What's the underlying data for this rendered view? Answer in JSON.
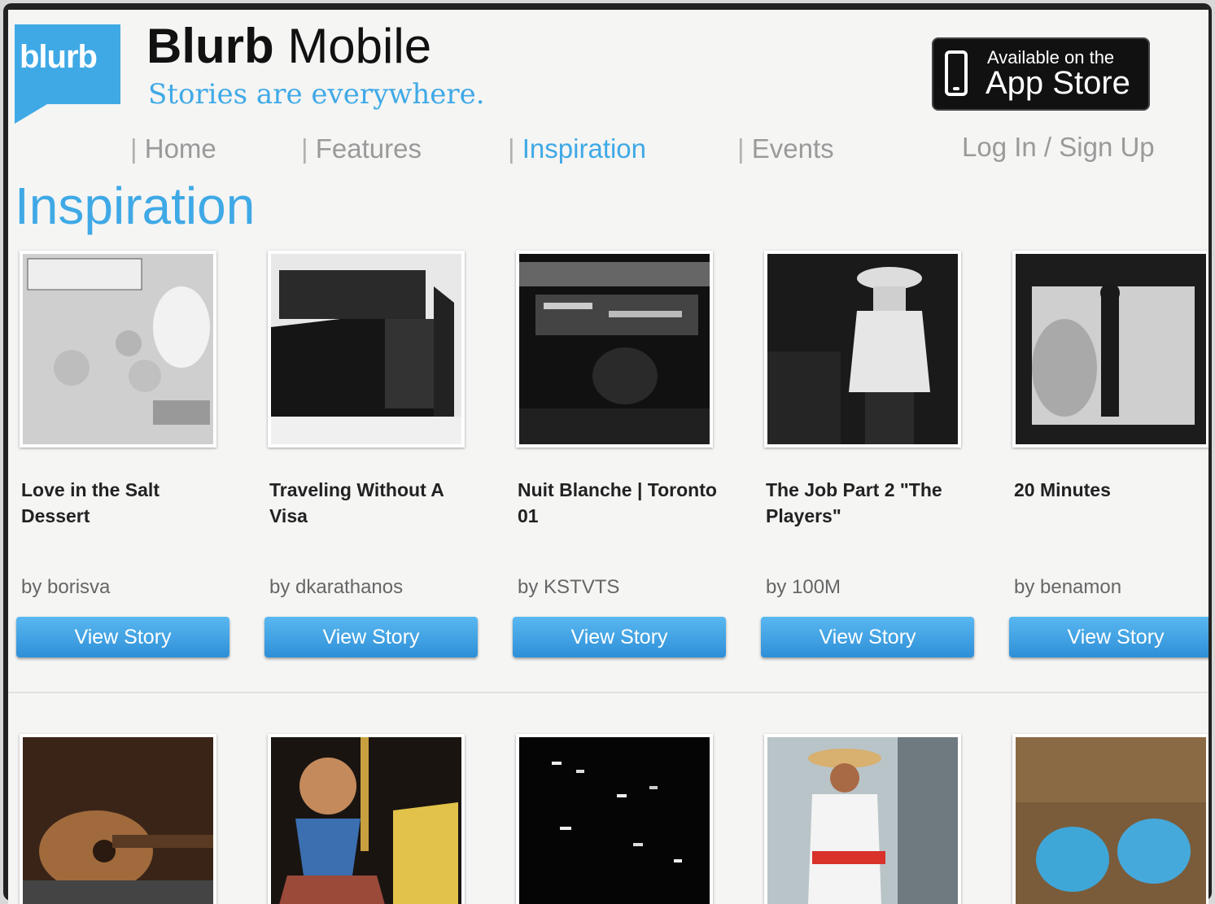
{
  "header": {
    "logo_text": "blurb",
    "brand_bold": "Blurb",
    "brand_rest": " Mobile",
    "tagline": "Stories are everywhere.",
    "appstore_small": "Available on the",
    "appstore_big": "App Store"
  },
  "nav": {
    "sep": "|",
    "home": "Home",
    "features": "Features",
    "inspiration": "Inspiration",
    "events": "Events",
    "login": "Log In / Sign Up"
  },
  "page_heading": "Inspiration",
  "stories": [
    {
      "title": "Love in the Salt Dessert",
      "author": "by borisva",
      "button": "View Story"
    },
    {
      "title": "Traveling Without A Visa",
      "author": "by dkarathanos",
      "button": "View Story"
    },
    {
      "title": "Nuit Blanche | Toronto 01",
      "author": "by KSTVTS",
      "button": "View Story"
    },
    {
      "title": "The Job Part 2 \"The Players\"",
      "author": "by 100M",
      "button": "View Story"
    },
    {
      "title": "20 Minutes",
      "author": "by benamon",
      "button": "View Story"
    }
  ]
}
